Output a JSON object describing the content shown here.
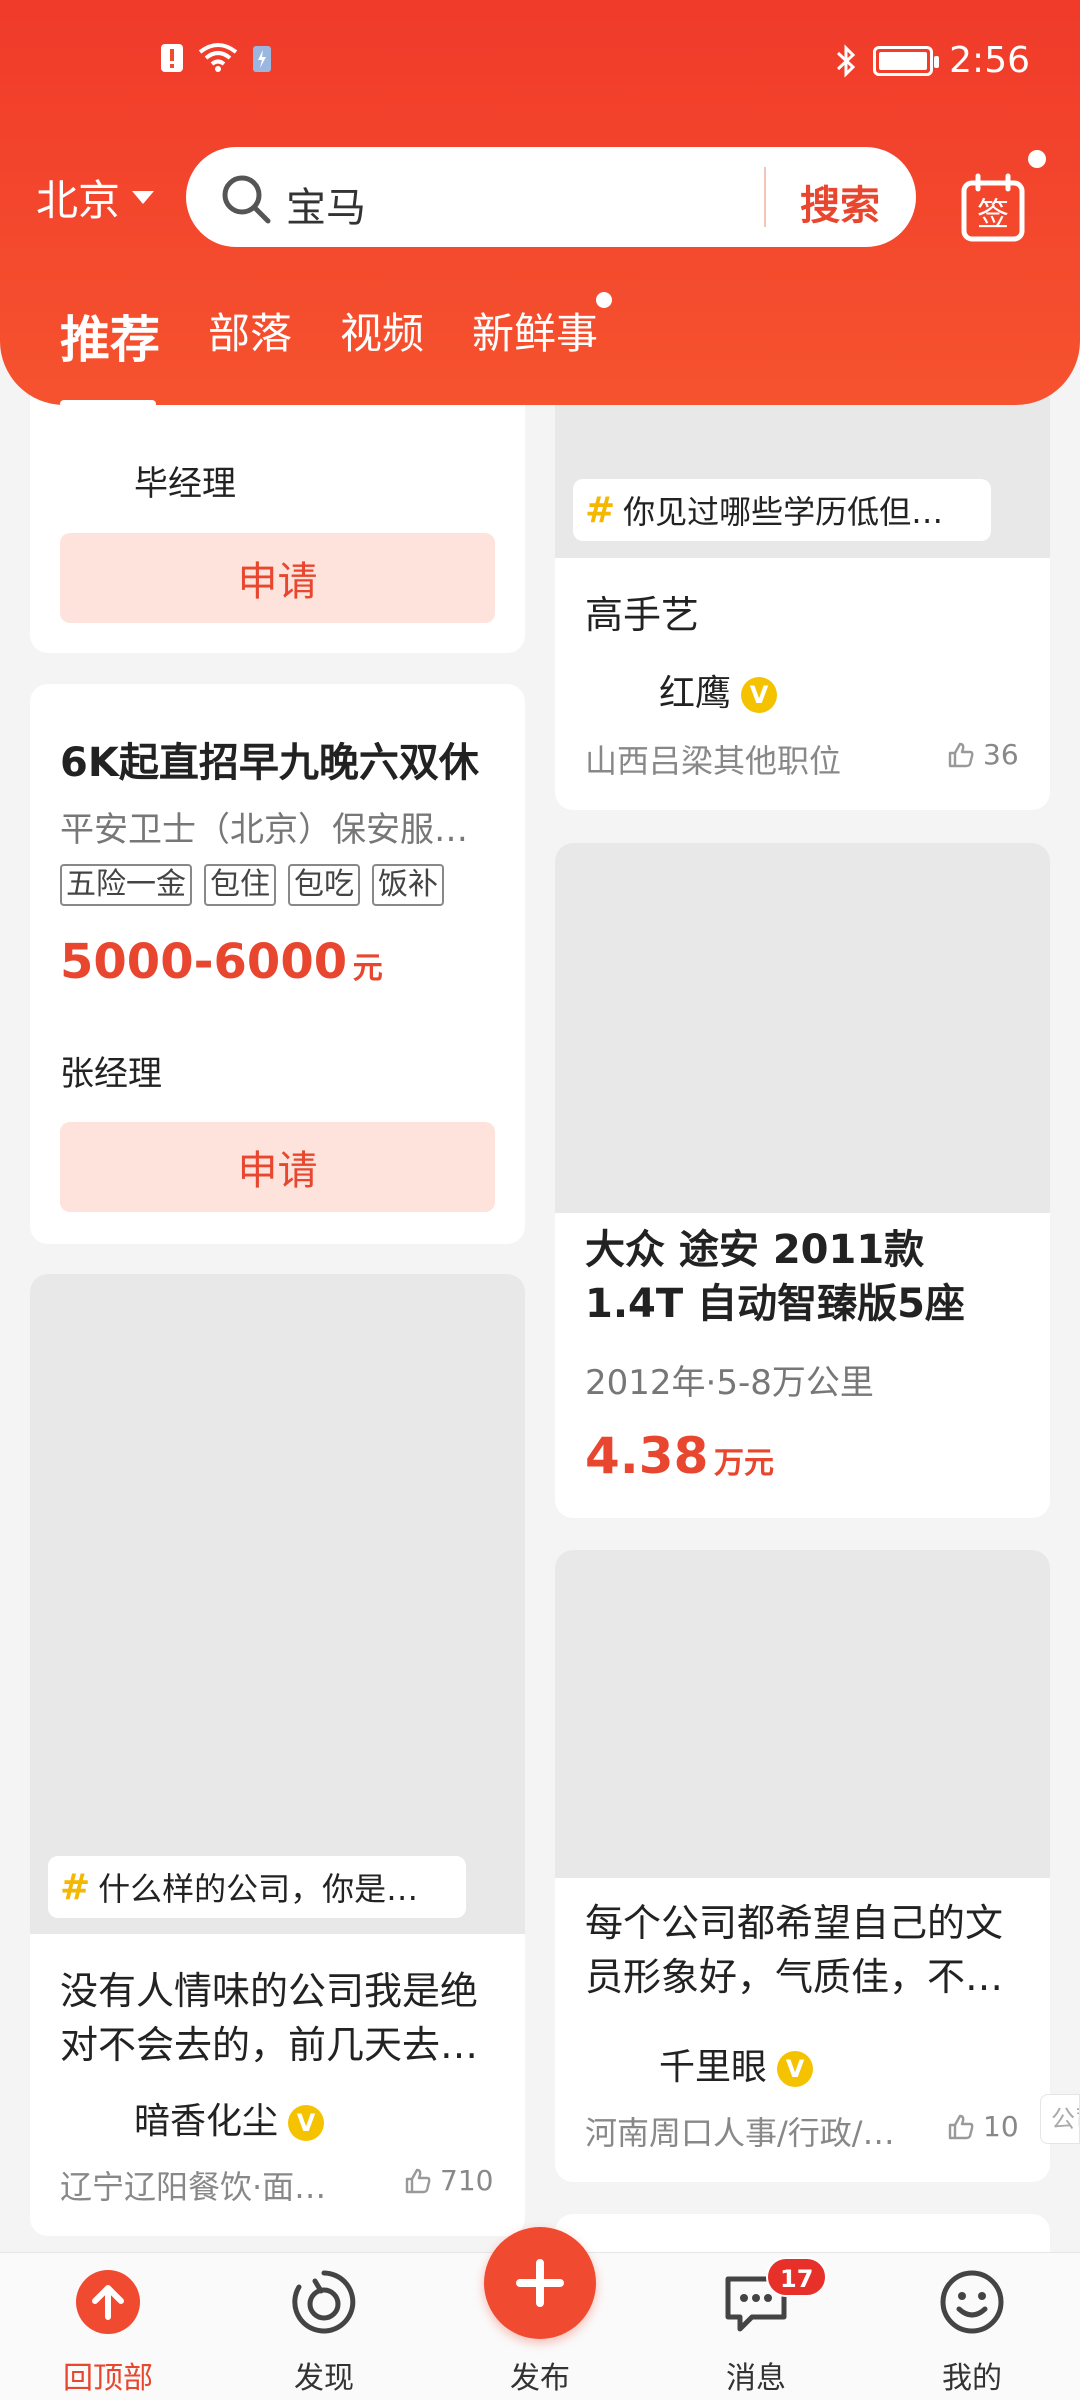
{
  "status_bar": {
    "time": "2:56"
  },
  "header": {
    "city": "北京",
    "search": {
      "query": "宝马",
      "button_label": "搜索"
    },
    "sign_label": "签",
    "tabs": [
      {
        "label": "推荐"
      },
      {
        "label": "部落"
      },
      {
        "label": "视频"
      },
      {
        "label": "新鲜事"
      }
    ]
  },
  "feed": {
    "left": [
      {
        "type": "job_tail",
        "contact": "毕经理",
        "apply_label": "申请"
      },
      {
        "type": "job",
        "title": "6K起直招早九晚六双休",
        "company": "平安卫士（北京）保安服…",
        "welfare": [
          "五险一金",
          "包住",
          "包吃",
          "饭补"
        ],
        "salary": "5000-6000",
        "salary_unit": "元",
        "contact": "张经理",
        "apply_label": "申请"
      },
      {
        "type": "post",
        "topic": "什么样的公司，你是…",
        "title": "没有人情味的公司我是绝对不会去的，前几天去…",
        "author": "暗香化尘",
        "verified_label": "V",
        "location": "辽宁辽阳餐饮·面…",
        "likes": "710"
      }
    ],
    "right": [
      {
        "type": "post_tail",
        "topic": "你见过哪些学历低但…",
        "title": "高手艺",
        "author": "红鹰",
        "verified_label": "V",
        "location": "山西吕梁其他职位",
        "likes": "36"
      },
      {
        "type": "car",
        "title": "大众 途安 2011款 1.4T 自动智臻版5座",
        "meta": "2012年·5-8万公里",
        "price": "4.38",
        "price_unit": "万元"
      },
      {
        "type": "post",
        "title": "每个公司都希望自己的文员形象好，气质佳，不…",
        "author": "千里眼",
        "verified_label": "V",
        "location": "河南周口人事/行政/…",
        "likes": "10",
        "edge_hint": "公司"
      }
    ]
  },
  "bottom_nav": {
    "items": [
      {
        "label": "回顶部"
      },
      {
        "label": "发现"
      },
      {
        "label": "发布"
      },
      {
        "label": "消息",
        "badge": "17"
      },
      {
        "label": "我的"
      }
    ]
  },
  "colors": {
    "accent": "#e8462e",
    "header": "#f04a31",
    "verified": "#f5c200"
  }
}
